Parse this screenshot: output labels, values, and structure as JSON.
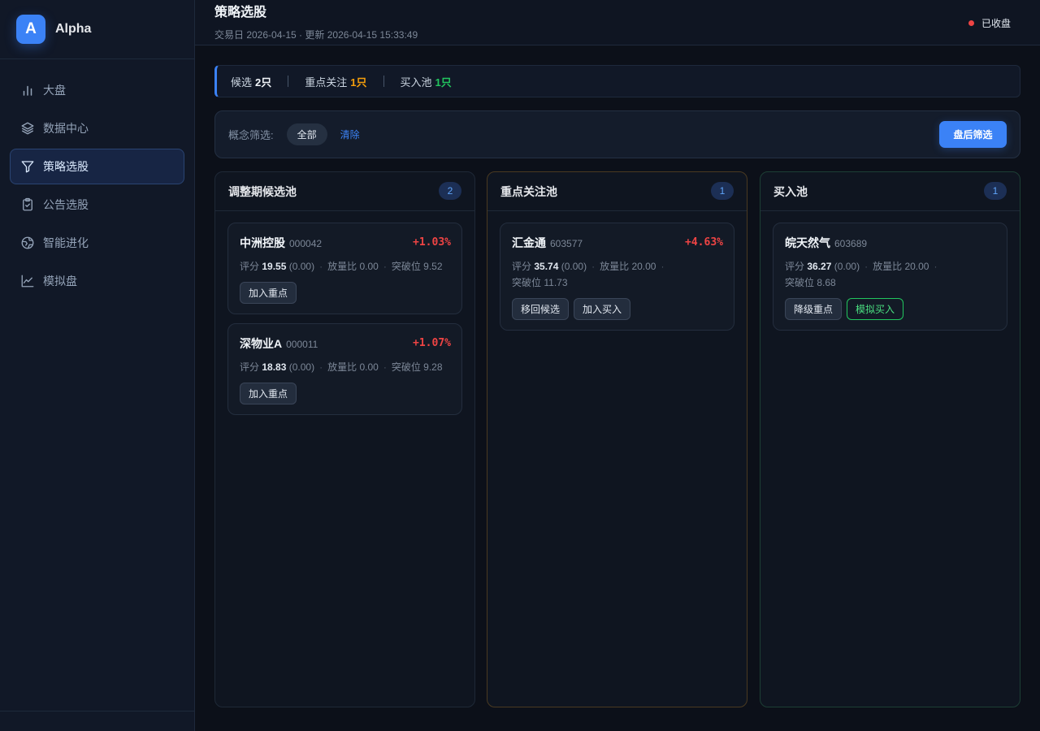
{
  "app": {
    "logo_letter": "A",
    "name": "Alpha"
  },
  "sidebar": {
    "items": [
      {
        "label": "大盘",
        "icon": "bar-chart-icon"
      },
      {
        "label": "数据中心",
        "icon": "layers-icon"
      },
      {
        "label": "策略选股",
        "icon": "filter-icon",
        "active": true
      },
      {
        "label": "公告选股",
        "icon": "clipboard-check-icon"
      },
      {
        "label": "智能进化",
        "icon": "globe-icon"
      },
      {
        "label": "模拟盘",
        "icon": "line-chart-icon"
      }
    ]
  },
  "header": {
    "title": "策略选股",
    "meta": "交易日 2026-04-15 · 更新 2026-04-15 15:33:49",
    "market_status": "已收盘"
  },
  "summary": {
    "candidates": {
      "label": "候选",
      "value": "2只"
    },
    "focus": {
      "label": "重点关注",
      "value": "1只"
    },
    "buy": {
      "label": "买入池",
      "value": "1只"
    }
  },
  "filter": {
    "label": "概念筛选:",
    "chip": "全部",
    "clear": "清除",
    "button": "盘后筛选"
  },
  "columns": [
    {
      "title": "调整期候选池",
      "count": "2",
      "cards": [
        {
          "name": "中洲控股",
          "code": "000042",
          "change": "+1.03%",
          "score_label": "评分",
          "score": "19.55",
          "score_delta": "(0.00)",
          "volume_label": "放量比",
          "volume": "0.00",
          "breakout_label": "突破位",
          "breakout": "9.52",
          "actions": [
            "加入重点"
          ]
        },
        {
          "name": "深物业A",
          "code": "000011",
          "change": "+1.07%",
          "score_label": "评分",
          "score": "18.83",
          "score_delta": "(0.00)",
          "volume_label": "放量比",
          "volume": "0.00",
          "breakout_label": "突破位",
          "breakout": "9.28",
          "actions": [
            "加入重点"
          ]
        }
      ]
    },
    {
      "title": "重点关注池",
      "count": "1",
      "cards": [
        {
          "name": "汇金通",
          "code": "603577",
          "change": "+4.63%",
          "score_label": "评分",
          "score": "35.74",
          "score_delta": "(0.00)",
          "volume_label": "放量比",
          "volume": "20.00",
          "breakout_label": "突破位",
          "breakout": "11.73",
          "actions": [
            "移回候选",
            "加入买入"
          ]
        }
      ]
    },
    {
      "title": "买入池",
      "count": "1",
      "cards": [
        {
          "name": "皖天然气",
          "code": "603689",
          "score_label": "评分",
          "score": "36.27",
          "score_delta": "(0.00)",
          "volume_label": "放量比",
          "volume": "20.00",
          "breakout_label": "突破位",
          "breakout": "8.68",
          "actions": [
            "降级重点",
            "模拟买入"
          ]
        }
      ]
    }
  ],
  "colors": {
    "accent": "#3b82f6",
    "up": "#ef4444",
    "focus": "#f59e0b",
    "buy": "#22c55e"
  }
}
